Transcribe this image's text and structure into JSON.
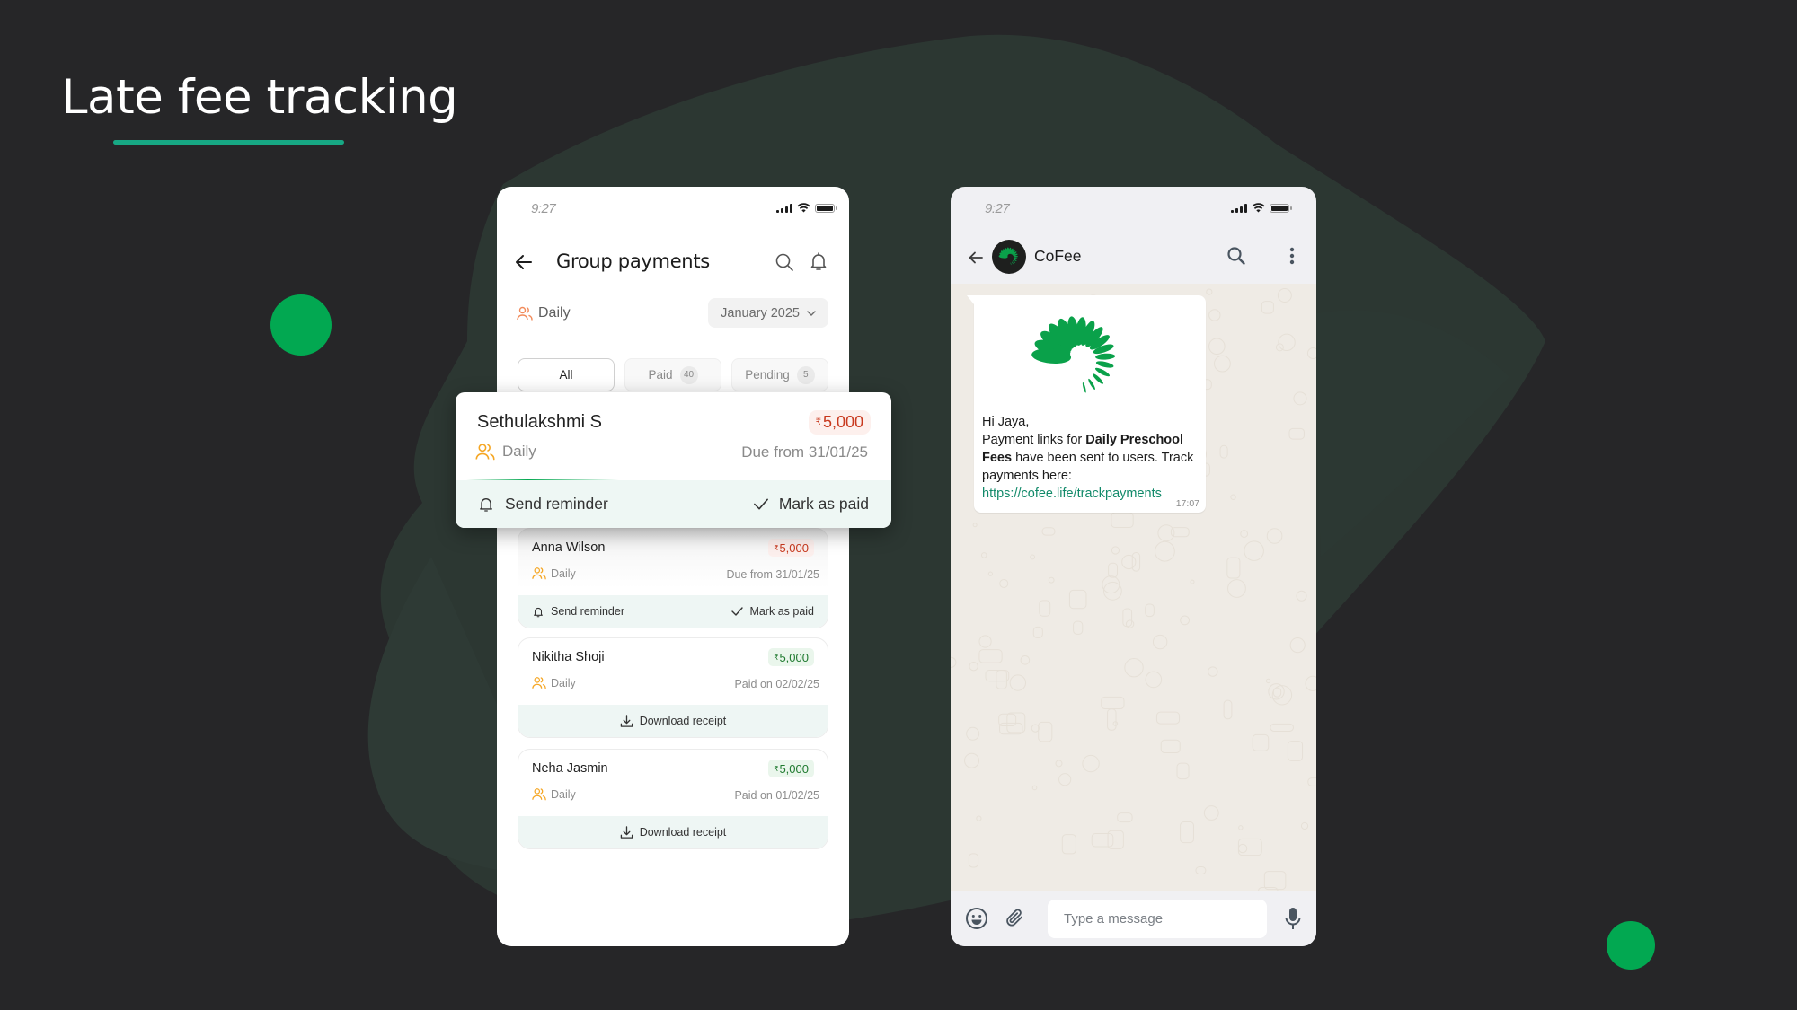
{
  "slide": {
    "title": "Late fee tracking",
    "accent_color": "#02a851",
    "underline_color": "#17a884"
  },
  "payments_app": {
    "status_time": "9:27",
    "header": {
      "title": "Group payments",
      "back_icon": "arrow-left-icon",
      "search_icon": "search-icon",
      "notification_icon": "bell-icon"
    },
    "group_filter": {
      "label": "Daily",
      "icon": "users-icon"
    },
    "month_select": {
      "value": "January 2025"
    },
    "tabs": [
      {
        "label": "All",
        "count": null,
        "active": true
      },
      {
        "label": "Paid",
        "count": "40",
        "active": false
      },
      {
        "label": "Pending",
        "count": "5",
        "active": false
      }
    ],
    "highlighted_card": {
      "name": "Sethulakshmi S",
      "currency": "₹",
      "amount": "5,000",
      "status": "due",
      "group": "Daily",
      "date_text": "Due from 31/01/25",
      "actions": {
        "reminder": "Send reminder",
        "mark_paid": "Mark as paid"
      }
    },
    "cards": [
      {
        "name": "Anna Wilson",
        "currency": "₹",
        "amount": "5,000",
        "status": "due",
        "group": "Daily",
        "date_text": "Due from 31/01/25",
        "actions": {
          "reminder": "Send reminder",
          "mark_paid": "Mark as paid"
        }
      },
      {
        "name": "Nikitha Shoji",
        "currency": "₹",
        "amount": "5,000",
        "status": "paid",
        "group": "Daily",
        "date_text": "Paid on 02/02/25",
        "actions": {
          "download": "Download receipt"
        }
      },
      {
        "name": "Neha Jasmin",
        "currency": "₹",
        "amount": "5,000",
        "status": "paid",
        "group": "Daily",
        "date_text": "Paid on 01/02/25",
        "actions": {
          "download": "Download receipt"
        }
      }
    ],
    "colors": {
      "due_text": "#c8381d",
      "due_bg": "#fcefed",
      "paid_text": "#1f7a2f",
      "paid_bg": "#eaf6ec",
      "group_icon": "#f5a623",
      "action_bg": "#eef6f4"
    }
  },
  "chat_app": {
    "status_time": "9:27",
    "contact_name": "CoFee",
    "message": {
      "greeting": "Hi Jaya,",
      "line_prefix": "Payment links for ",
      "bold_text_1": "Daily Preschool",
      "bold_text_2": "Fees",
      "line_suffix": " have been sent to users. Track payments here:",
      "link": "https://cofee.life/trackpayments",
      "time": "17:07"
    },
    "input_placeholder": "Type a message",
    "colors": {
      "logo_green": "#0aa14a",
      "link": "#128a6a",
      "chat_bg": "#efebe5"
    }
  }
}
